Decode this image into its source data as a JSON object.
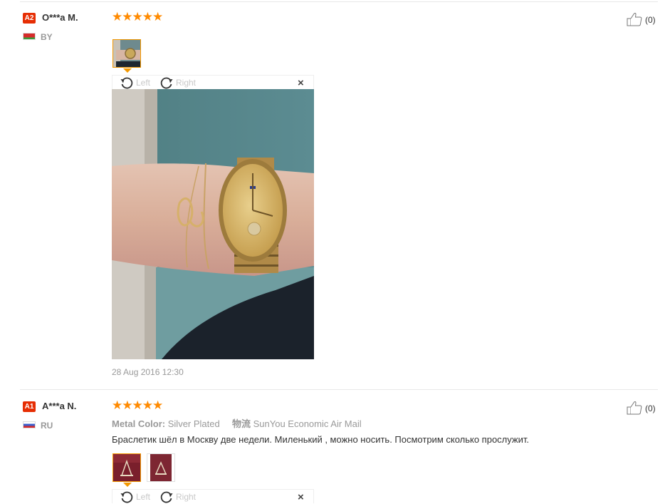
{
  "reviews": [
    {
      "level": "A2",
      "level_color": "#e62e04",
      "name": "O***a M.",
      "country": "BY",
      "stars": "★★★★★",
      "likes": "(0)",
      "viewer": {
        "left_label": "Left",
        "right_label": "Right",
        "close": "×"
      },
      "date": "28 Aug 2016 12:30"
    },
    {
      "level": "A1",
      "level_color": "#e62e04",
      "name": "A***a N.",
      "country": "RU",
      "stars": "★★★★★",
      "likes": "(0)",
      "meta": {
        "color_key": "Metal Color:",
        "color_value": "Silver Plated",
        "shipping_key": "物流",
        "shipping_value": "SunYou Economic Air Mail"
      },
      "text": "Браслетик шёл в Москву две недели. Миленький , можно носить. Посмотрим сколько прослужит.",
      "viewer": {
        "left_label": "Left",
        "right_label": "Right",
        "close": "×"
      }
    }
  ],
  "colors": {
    "star": "#ff8a00",
    "accent_border": "#f39800",
    "muted_text": "#999999"
  }
}
